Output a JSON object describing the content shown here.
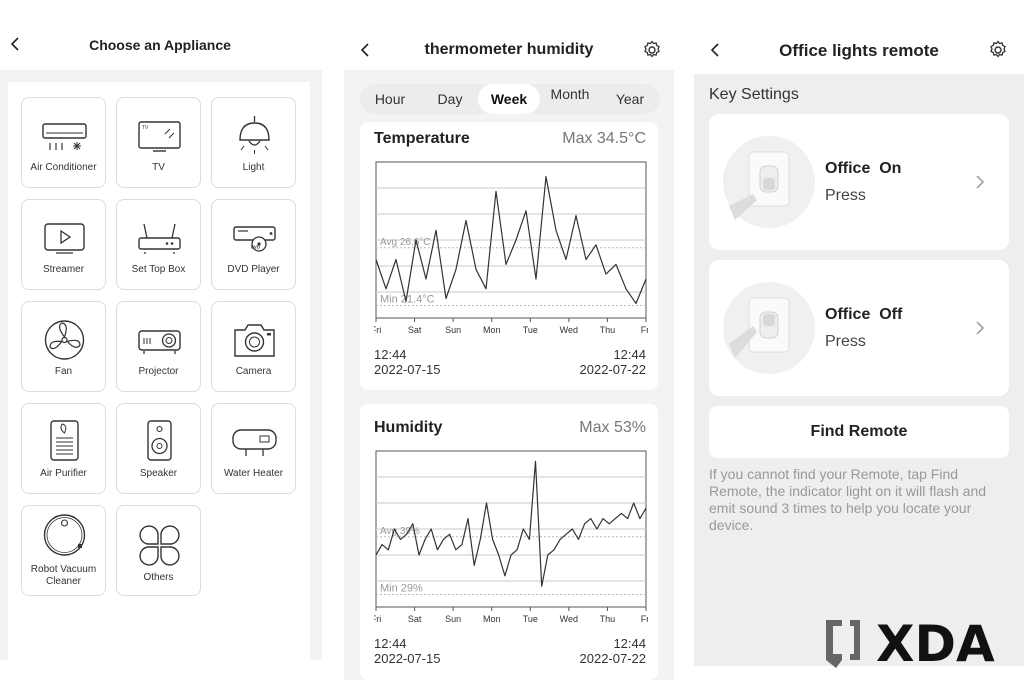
{
  "appliances": {
    "title": "Choose an Appliance",
    "items": [
      {
        "label": "Air Conditioner",
        "icon": "air-conditioner-icon"
      },
      {
        "label": "TV",
        "icon": "tv-icon"
      },
      {
        "label": "Light",
        "icon": "light-icon"
      },
      {
        "label": "Streamer",
        "icon": "streamer-icon"
      },
      {
        "label": "Set Top Box",
        "icon": "set-top-box-icon"
      },
      {
        "label": "DVD Player",
        "icon": "dvd-player-icon"
      },
      {
        "label": "Fan",
        "icon": "fan-icon"
      },
      {
        "label": "Projector",
        "icon": "projector-icon"
      },
      {
        "label": "Camera",
        "icon": "camera-icon"
      },
      {
        "label": "Air Purifier",
        "icon": "air-purifier-icon"
      },
      {
        "label": "Speaker",
        "icon": "speaker-icon"
      },
      {
        "label": "Water Heater",
        "icon": "water-heater-icon"
      },
      {
        "label": "Robot Vacuum Cleaner",
        "icon": "robot-vacuum-icon"
      },
      {
        "label": "Others",
        "icon": "others-icon"
      }
    ],
    "icon_labels": {
      "tv": "TV",
      "dvd": "DVD"
    }
  },
  "thermo": {
    "title": "thermometer humidity",
    "tabs": [
      "Hour",
      "Day",
      "Week",
      "Month",
      "Year"
    ],
    "active_tab": "Week",
    "temperature": {
      "title": "Temperature",
      "max": "Max 34.5°C",
      "avg": "Avg 26.6°C",
      "min": "Min 21.4°C",
      "start_time": "12:44",
      "start_date": "2022-07-15",
      "end_time": "12:44",
      "end_date": "2022-07-22"
    },
    "humidity": {
      "title": "Humidity",
      "max": "Max 53%",
      "avg": "Avg 39%",
      "min": "Min 29%",
      "start_time": "12:44",
      "start_date": "2022-07-15",
      "end_time": "12:44",
      "end_date": "2022-07-22"
    }
  },
  "chart_data": [
    {
      "type": "line",
      "title": "Temperature",
      "x": [
        "Fri",
        "Sat",
        "Sun",
        "Mon",
        "Tue",
        "Wed",
        "Thu",
        "Fri"
      ],
      "xlabel": "",
      "ylabel": "",
      "ylim": [
        20,
        36
      ],
      "grid": true,
      "series": [
        {
          "values": [
            26,
            23,
            26,
            21.7,
            28,
            24,
            29,
            22,
            25,
            30,
            25,
            23,
            33,
            25.5,
            28,
            31,
            24,
            34.5,
            29,
            26,
            30.5,
            26,
            27.5,
            24.5,
            25.5,
            23,
            21.5,
            24
          ]
        }
      ],
      "annotations": [
        "Max 34.5°C",
        "Avg 26.6°C",
        "Min 21.4°C"
      ]
    },
    {
      "type": "line",
      "title": "Humidity",
      "x": [
        "Fri",
        "Sat",
        "Sun",
        "Mon",
        "Tue",
        "Wed",
        "Thu",
        "Fri"
      ],
      "xlabel": "",
      "ylabel": "",
      "ylim": [
        25,
        55
      ],
      "grid": true,
      "series": [
        {
          "values": [
            35,
            37,
            36,
            40,
            38,
            39,
            41,
            35,
            38,
            40,
            36,
            38,
            39,
            36,
            37,
            42,
            33,
            38,
            45,
            38,
            35,
            31,
            35,
            36,
            40,
            38,
            53,
            29,
            35,
            36,
            38,
            39,
            40,
            38,
            41,
            42,
            40,
            42,
            41,
            42,
            43,
            42,
            45,
            42,
            44
          ]
        }
      ],
      "annotations": [
        "Max 53%",
        "Avg 39%",
        "Min 29%"
      ]
    }
  ],
  "remote": {
    "title": "Office lights remote",
    "section_title": "Key Settings",
    "keys": [
      {
        "name": "Office  On",
        "action": "Press"
      },
      {
        "name": "Office  Off",
        "action": "Press"
      }
    ],
    "find_button": "Find Remote",
    "hint": "If you cannot find your Remote, tap Find Remote, the indicator light on it will flash and emit sound 3 times to help you locate your device."
  },
  "watermark": {
    "brand": "XDA"
  },
  "colors": {
    "background": "#f3f3f3",
    "card": "#ffffff",
    "line": "#333333"
  }
}
